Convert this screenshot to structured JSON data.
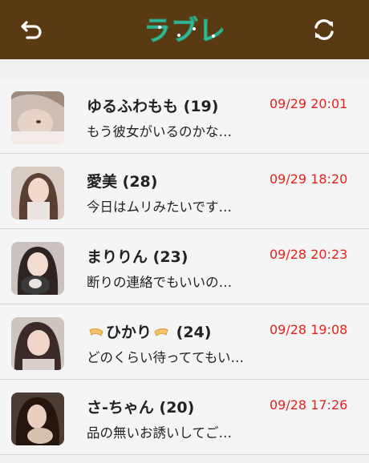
{
  "header": {
    "title": "ラブレ",
    "back_icon": "back-icon",
    "refresh_icon": "refresh-icon",
    "background": "#5a3a12",
    "logo_color": "#3cc6a0"
  },
  "messages": [
    {
      "name": "ゆるふわもも",
      "age": "(19)",
      "time": "09/29 20:01",
      "preview": "もう彼女がいるのかな…",
      "ribbon": false
    },
    {
      "name": "愛美",
      "age": "(28)",
      "time": "09/29 18:20",
      "preview": "今日はムリみたいです…",
      "ribbon": false
    },
    {
      "name": "まりりん",
      "age": "(23)",
      "time": "09/28 20:23",
      "preview": "断りの連絡でもいいの…",
      "ribbon": false
    },
    {
      "name": "ひかり",
      "age": "(24)",
      "time": "09/28 19:08",
      "preview": "どのくらい待っててもい…",
      "ribbon": true
    },
    {
      "name": "さ-ちゃん",
      "age": "(20)",
      "time": "09/28 17:26",
      "preview": "品の無いお誘いしてご…",
      "ribbon": false
    }
  ],
  "colors": {
    "time": "#e8211d",
    "text": "#222222"
  }
}
